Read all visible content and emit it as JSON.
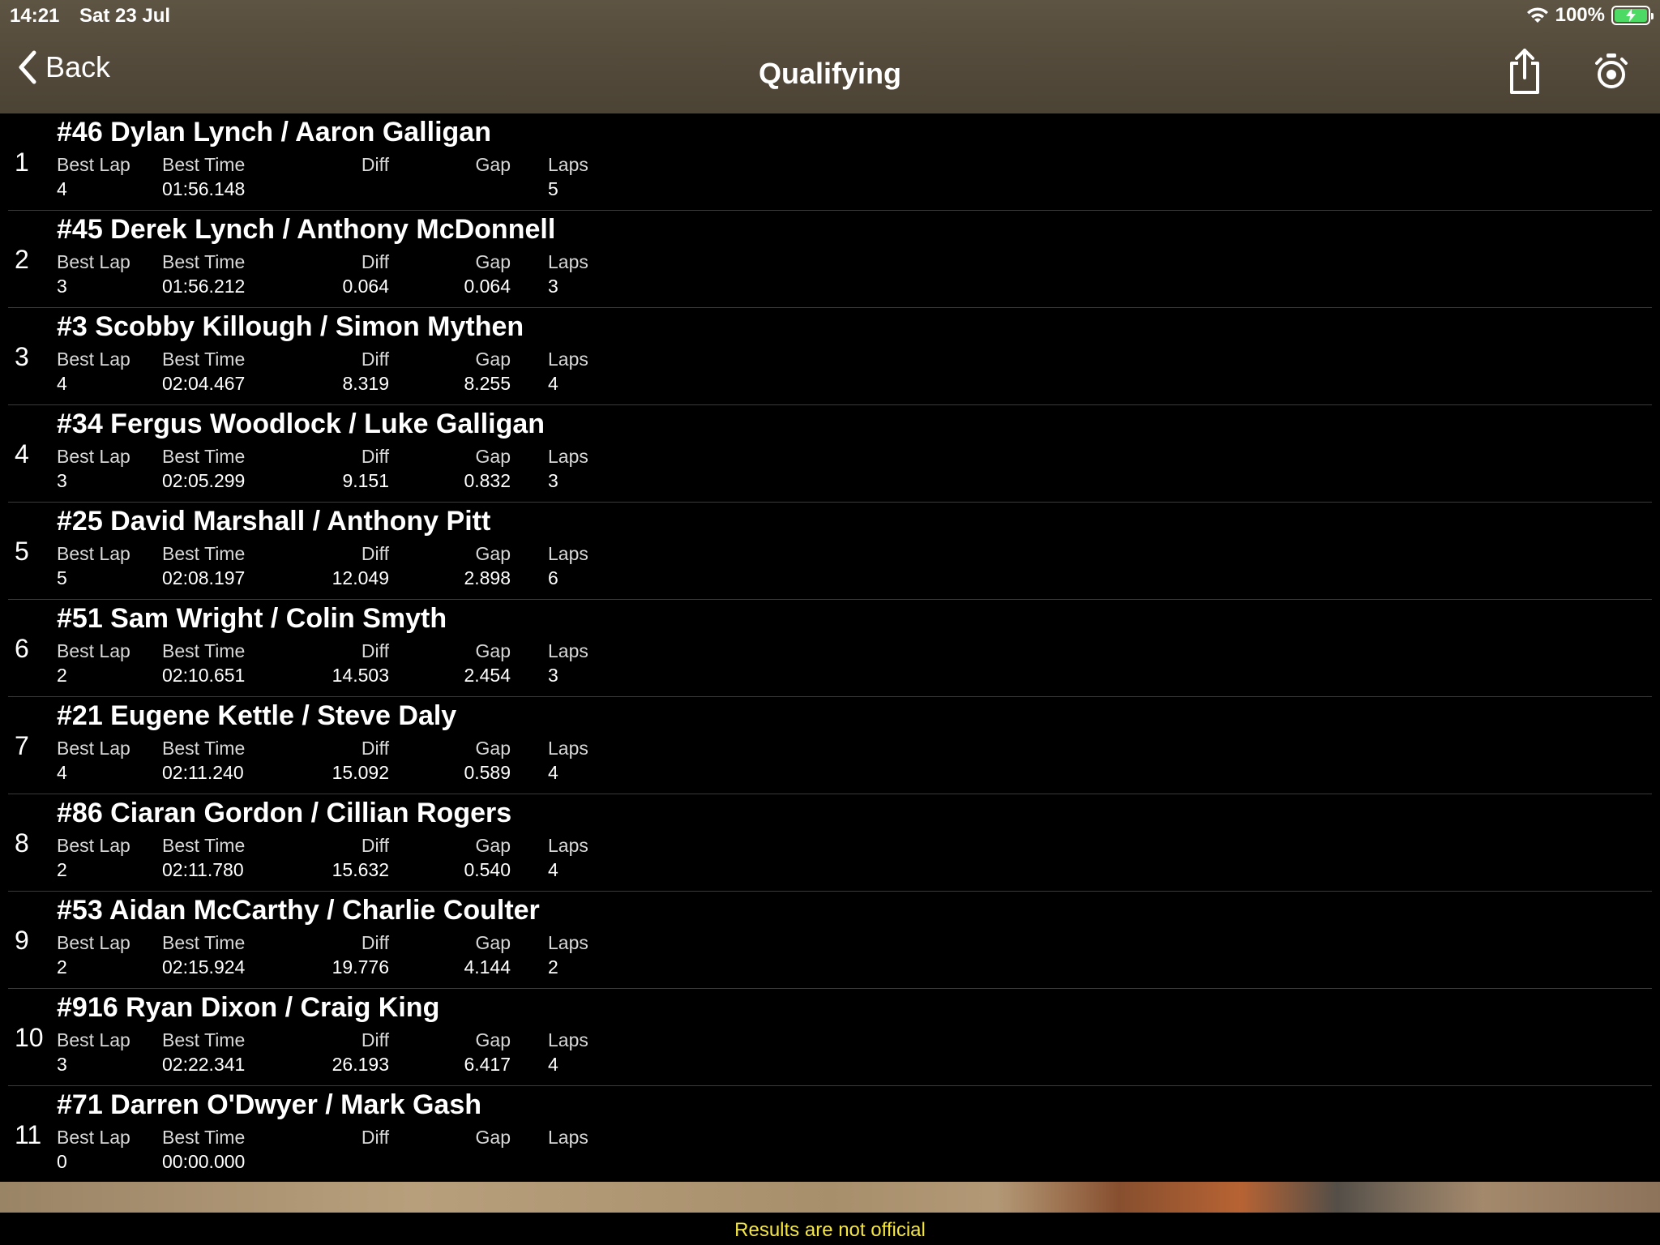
{
  "status_bar": {
    "time": "14:21",
    "date": "Sat 23 Jul",
    "battery": "100%"
  },
  "nav": {
    "back_label": "Back",
    "title": "Qualifying",
    "share_icon": "share-icon",
    "timer_icon": "stopwatch-icon"
  },
  "columns": {
    "best_lap": "Best Lap",
    "best_time": "Best Time",
    "diff": "Diff",
    "gap": "Gap",
    "laps": "Laps"
  },
  "results": [
    {
      "pos": "1",
      "name": "#46 Dylan Lynch / Aaron Galligan",
      "best_lap": "4",
      "best_time": "01:56.148",
      "diff": "",
      "gap": "",
      "laps": "5"
    },
    {
      "pos": "2",
      "name": "#45 Derek Lynch / Anthony McDonnell",
      "best_lap": "3",
      "best_time": "01:56.212",
      "diff": "0.064",
      "gap": "0.064",
      "laps": "3"
    },
    {
      "pos": "3",
      "name": "#3 Scobby Killough / Simon Mythen",
      "best_lap": "4",
      "best_time": "02:04.467",
      "diff": "8.319",
      "gap": "8.255",
      "laps": "4"
    },
    {
      "pos": "4",
      "name": "#34 Fergus Woodlock / Luke Galligan",
      "best_lap": "3",
      "best_time": "02:05.299",
      "diff": "9.151",
      "gap": "0.832",
      "laps": "3"
    },
    {
      "pos": "5",
      "name": "#25 David Marshall / Anthony Pitt",
      "best_lap": "5",
      "best_time": "02:08.197",
      "diff": "12.049",
      "gap": "2.898",
      "laps": "6"
    },
    {
      "pos": "6",
      "name": "#51 Sam Wright / Colin Smyth",
      "best_lap": "2",
      "best_time": "02:10.651",
      "diff": "14.503",
      "gap": "2.454",
      "laps": "3"
    },
    {
      "pos": "7",
      "name": "#21 Eugene Kettle / Steve Daly",
      "best_lap": "4",
      "best_time": "02:11.240",
      "diff": "15.092",
      "gap": "0.589",
      "laps": "4"
    },
    {
      "pos": "8",
      "name": "#86 Ciaran Gordon / Cillian Rogers",
      "best_lap": "2",
      "best_time": "02:11.780",
      "diff": "15.632",
      "gap": "0.540",
      "laps": "4"
    },
    {
      "pos": "9",
      "name": "#53 Aidan McCarthy / Charlie Coulter",
      "best_lap": "2",
      "best_time": "02:15.924",
      "diff": "19.776",
      "gap": "4.144",
      "laps": "2"
    },
    {
      "pos": "10",
      "name": "#916 Ryan Dixon / Craig King",
      "best_lap": "3",
      "best_time": "02:22.341",
      "diff": "26.193",
      "gap": "6.417",
      "laps": "4"
    },
    {
      "pos": "11",
      "name": "#71 Darren O'Dwyer / Mark Gash",
      "best_lap": "0",
      "best_time": "00:00.000",
      "diff": "",
      "gap": "",
      "laps": ""
    }
  ],
  "footer": {
    "notice": "Results are not official"
  },
  "colors": {
    "header_bg": "#53493a",
    "notice": "#f5e642",
    "battery": "#4cd964"
  }
}
